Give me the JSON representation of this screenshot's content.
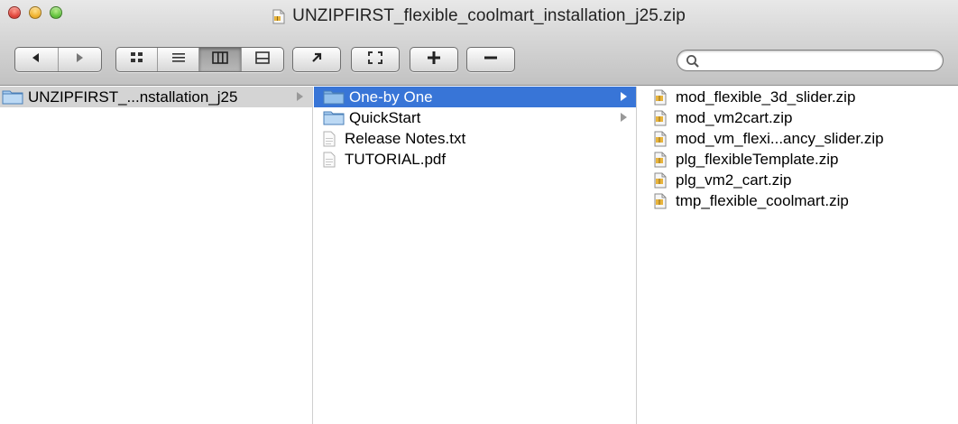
{
  "window": {
    "title": "UNZIPFIRST_flexible_coolmart_installation_j25.zip"
  },
  "toolbar": {
    "back_icon": "back-arrow-icon",
    "forward_icon": "forward-arrow-icon",
    "view_modes": [
      "icon-view-icon",
      "list-view-icon",
      "column-view-icon",
      "coverflow-view-icon"
    ],
    "active_view": "column-view-icon",
    "action_icons": [
      "share-arrow-icon",
      "fullscreen-icon",
      "plus-icon",
      "minus-icon"
    ]
  },
  "search": {
    "value": "",
    "placeholder": ""
  },
  "columns": {
    "col1": [
      {
        "name": "UNZIPFIRST_...nstallation_j25",
        "type": "folder",
        "state": "inactive-selected",
        "has_arrow": true
      }
    ],
    "col2": [
      {
        "name": "One-by One",
        "type": "folder",
        "state": "active-selected",
        "has_arrow": true
      },
      {
        "name": "QuickStart",
        "type": "folder",
        "state": "none",
        "has_arrow": true
      },
      {
        "name": "Release Notes.txt",
        "type": "text",
        "state": "none",
        "has_arrow": false
      },
      {
        "name": "TUTORIAL.pdf",
        "type": "text",
        "state": "none",
        "has_arrow": false
      }
    ],
    "col3": [
      {
        "name": "mod_flexible_3d_slider.zip",
        "type": "zip"
      },
      {
        "name": "mod_vm2cart.zip",
        "type": "zip"
      },
      {
        "name": "mod_vm_flexi...ancy_slider.zip",
        "type": "zip"
      },
      {
        "name": "plg_flexibleTemplate.zip",
        "type": "zip"
      },
      {
        "name": "plg_vm2_cart.zip",
        "type": "zip"
      },
      {
        "name": "tmp_flexible_coolmart.zip",
        "type": "zip"
      }
    ]
  },
  "colors": {
    "selection_active": "#3875d7",
    "selection_inactive": "#d4d4d4",
    "folder_blue": "#7fb2e5"
  }
}
